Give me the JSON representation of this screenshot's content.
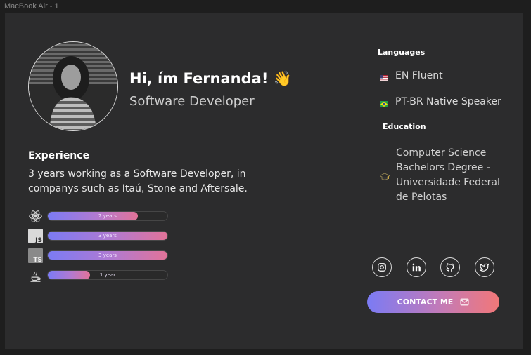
{
  "frame": {
    "label": "MacBook Air - 1"
  },
  "profile": {
    "greeting": "Hi, ím Fernanda! 👋",
    "role": "Software Developer"
  },
  "experience": {
    "title": "Experience",
    "description": "3 years working as a Software Developer, in companys such as Itaú, Stone and Aftersale."
  },
  "skills": [
    {
      "icon": "react-icon",
      "label": "2 years",
      "level": 0.75
    },
    {
      "icon": "javascript-icon",
      "icon_text": "JS",
      "label": "3 years",
      "level": 1.0
    },
    {
      "icon": "typescript-icon",
      "icon_text": "TS",
      "label": "3 years",
      "level": 1.0
    },
    {
      "icon": "java-icon",
      "label": "1 year",
      "level": 0.35
    }
  ],
  "languages": {
    "title": "Languages",
    "items": [
      {
        "flag": "us-flag-icon",
        "text": "EN  Fluent"
      },
      {
        "flag": "brazil-flag-icon",
        "text": "PT-BR Native Speaker"
      }
    ]
  },
  "education": {
    "title": "Education",
    "text": "Computer Science Bachelors Degree - Universidade Federal de Pelotas",
    "icon": "graduation-cap-icon"
  },
  "social": [
    "instagram-icon",
    "linkedin-icon",
    "github-icon",
    "twitter-icon"
  ],
  "contact": {
    "label": "CONTACT ME",
    "icon": "mail-icon"
  },
  "colors": {
    "background": "#1e1e1e",
    "card": "#2c2c2d",
    "gradient_start": "#7b7bf4",
    "gradient_end": "#f27878"
  }
}
